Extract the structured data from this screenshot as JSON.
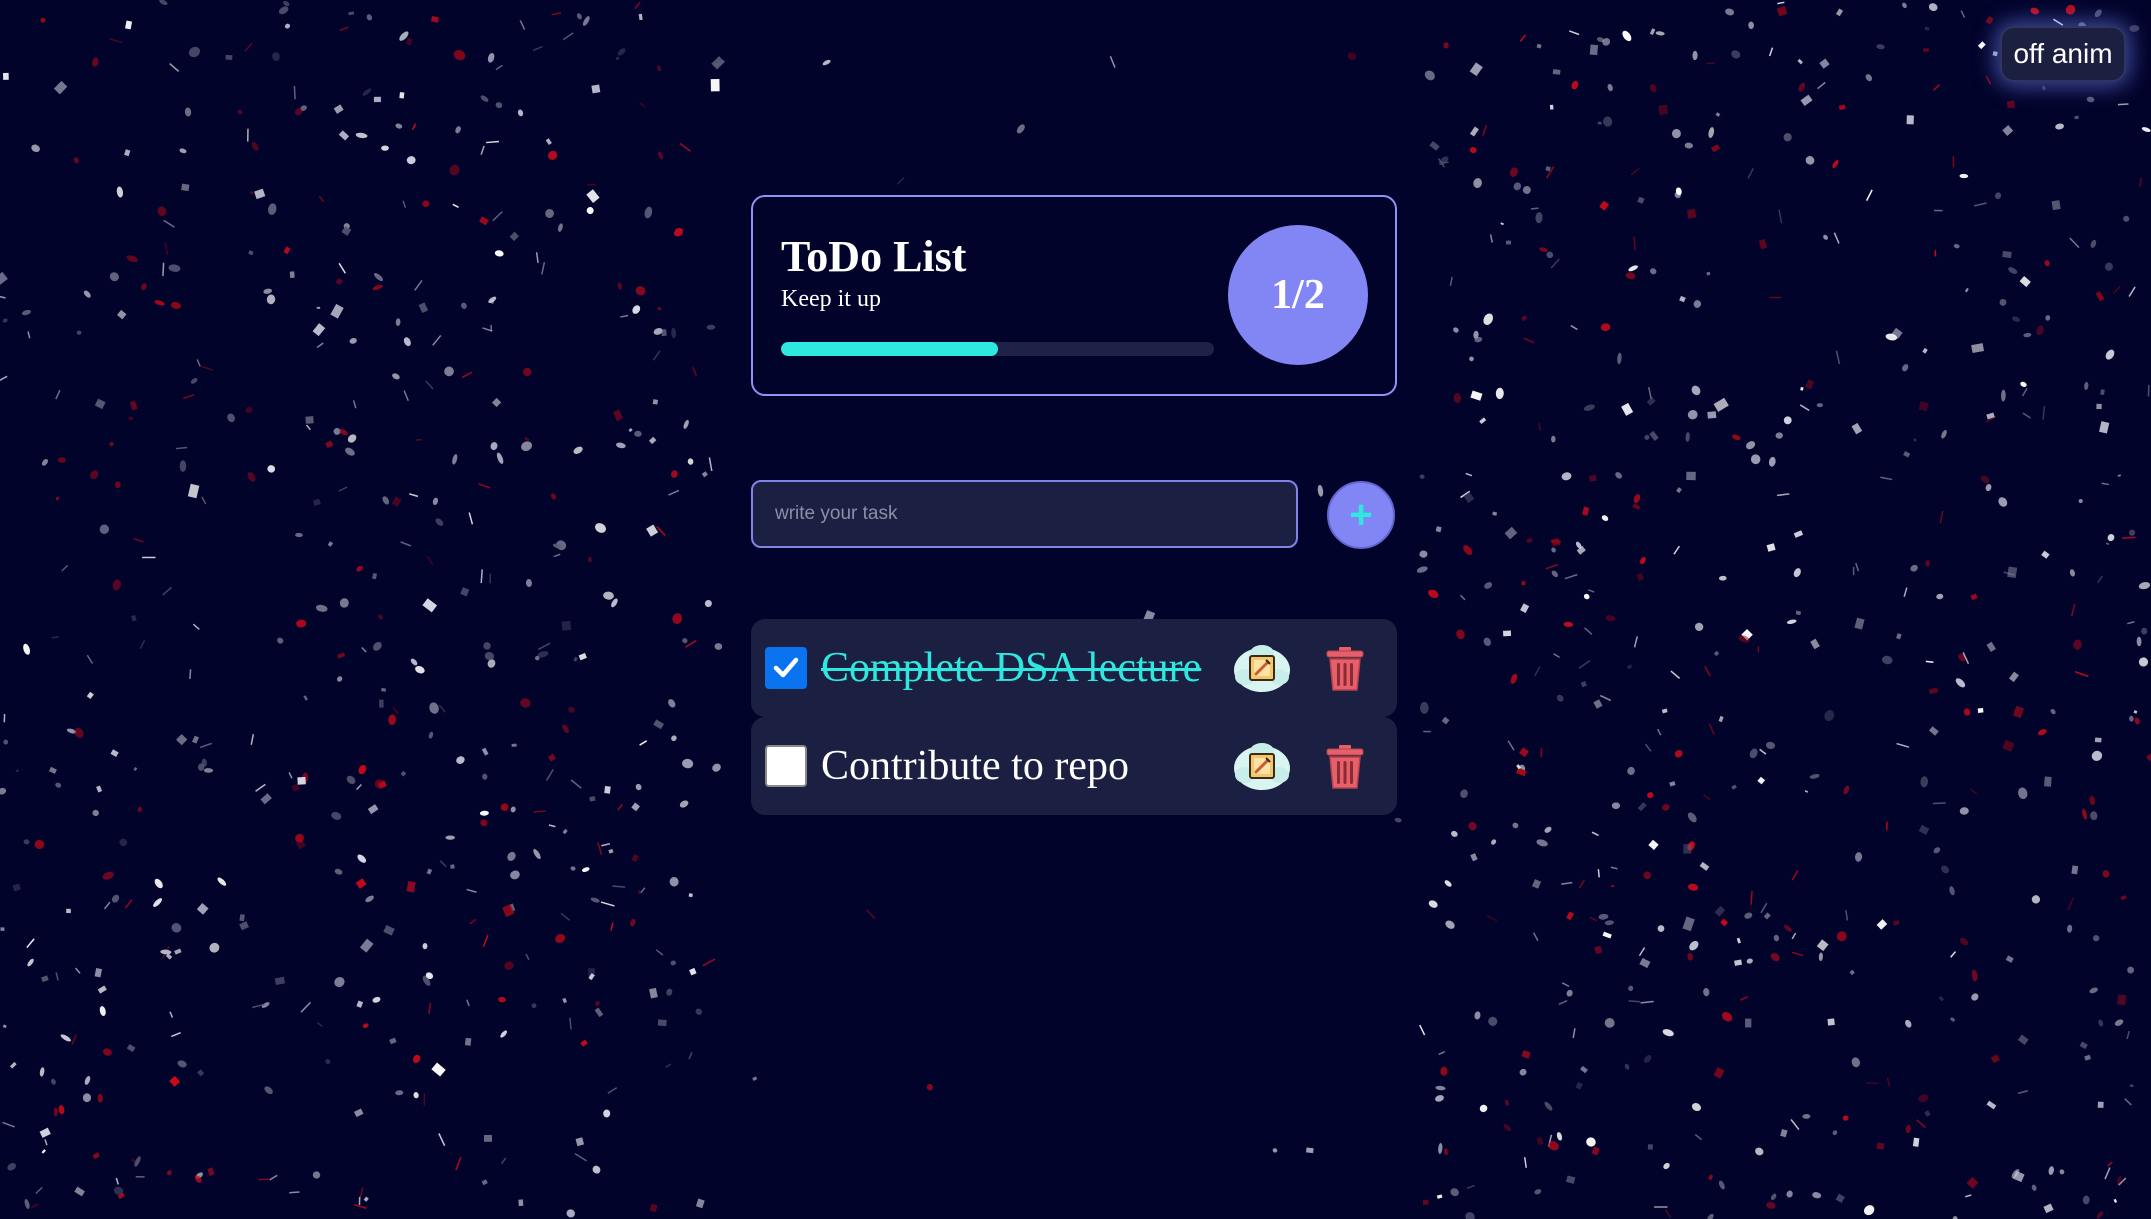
{
  "animation_toggle": {
    "label": "off anim"
  },
  "header": {
    "title": "ToDo List",
    "subtitle": "Keep it up",
    "progress_fraction": 0.5,
    "count_label": "1/2"
  },
  "input": {
    "placeholder": "write your task",
    "value": ""
  },
  "add_button": {
    "label": "+"
  },
  "todos": [
    {
      "text": "Complete DSA lecture",
      "completed": true
    },
    {
      "text": "Contribute to repo",
      "completed": false
    }
  ],
  "icons": {
    "edit": "edit-icon",
    "delete": "trash-icon",
    "check": "checkmark-icon"
  },
  "colors": {
    "background": "#02032b",
    "accent_purple": "#8286f4",
    "accent_cyan": "#2ee8e0",
    "delete_red": "#e5606a",
    "checkbox_blue": "#0a74f0",
    "card_bg": "#1b1f42"
  }
}
